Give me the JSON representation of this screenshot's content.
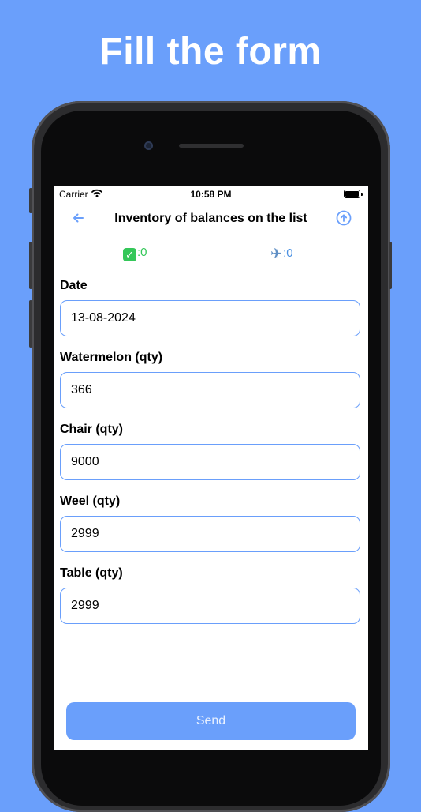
{
  "promo": {
    "headline": "Fill the form"
  },
  "status_bar": {
    "carrier": "Carrier",
    "time": "10:58 PM"
  },
  "nav": {
    "title": "Inventory of balances on the list"
  },
  "counters": {
    "success_count": ":0",
    "sent_count": ":0"
  },
  "form": {
    "fields": [
      {
        "label": "Date",
        "value": "13-08-2024"
      },
      {
        "label": "Watermelon (qty)",
        "value": "366"
      },
      {
        "label": "Chair (qty)",
        "value": "9000"
      },
      {
        "label": "Weel (qty)",
        "value": "2999"
      },
      {
        "label": "Table (qty)",
        "value": "2999"
      }
    ],
    "send_label": "Send"
  },
  "colors": {
    "accent": "#6a9ffb",
    "success": "#34c759",
    "background": "#6a9ffb"
  },
  "icons": [
    "wifi-icon",
    "battery-icon",
    "back-arrow-icon",
    "upload-icon",
    "checkmark-icon",
    "airplane-icon"
  ]
}
